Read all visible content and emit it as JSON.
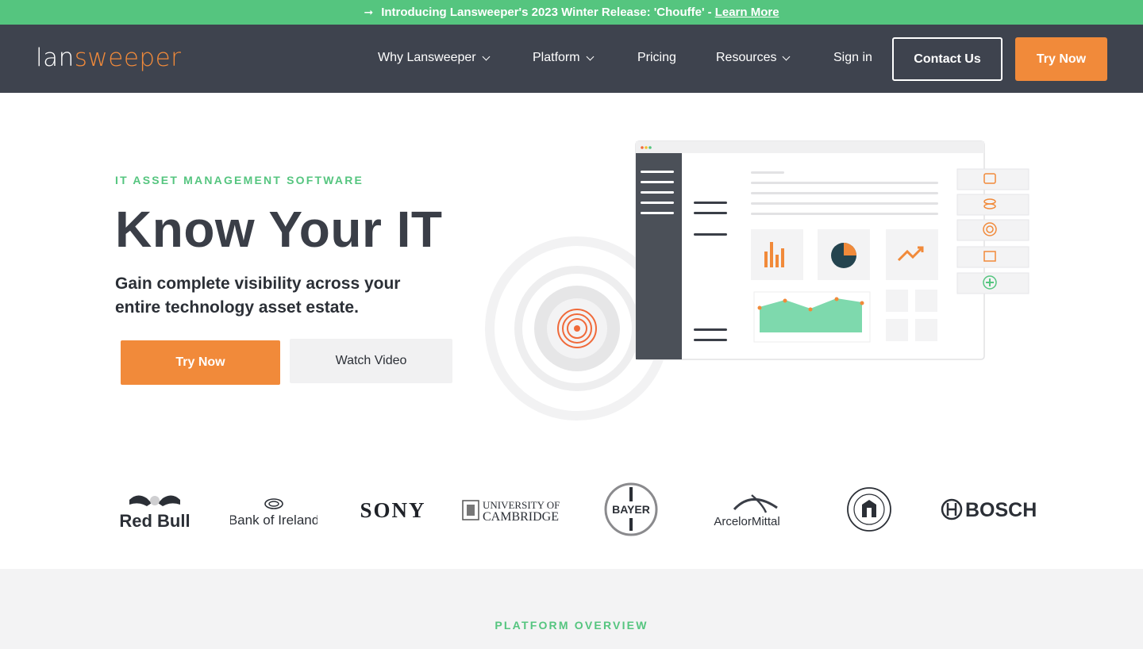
{
  "announcement": {
    "text": "Introducing Lansweeper's 2023 Winter Release: 'Chouffe' -",
    "link": "Learn More",
    "icon": "arrow-right-icon"
  },
  "header": {
    "logo_left": "lan",
    "logo_right": "sweeper",
    "nav": {
      "why": "Why Lansweeper",
      "platform": "Platform",
      "pricing": "Pricing",
      "resources": "Resources",
      "signin": "Sign in"
    },
    "contact": "Contact Us",
    "try": "Try Now"
  },
  "hero": {
    "eyebrow": "IT ASSET MANAGEMENT SOFTWARE",
    "title": "Know Your IT",
    "subtitle": "Gain complete visibility across your entire technology asset estate.",
    "try_button": "Try Now",
    "video_button": "Watch Video"
  },
  "customer_logos": {
    "redbull": "Red Bull",
    "boi": "Bank of Ireland",
    "sony": "SONY",
    "cambridge_1": "UNIVERSITY OF",
    "cambridge_2": "CAMBRIDGE",
    "bayer": "BAYER",
    "arcelor": "ArcelorMittal",
    "bosch": "BOSCH"
  },
  "platform": {
    "eyebrow": "PLATFORM OVERVIEW"
  },
  "colors": {
    "green": "#55c57f",
    "orange": "#f18a3a",
    "header": "#3e434e"
  }
}
